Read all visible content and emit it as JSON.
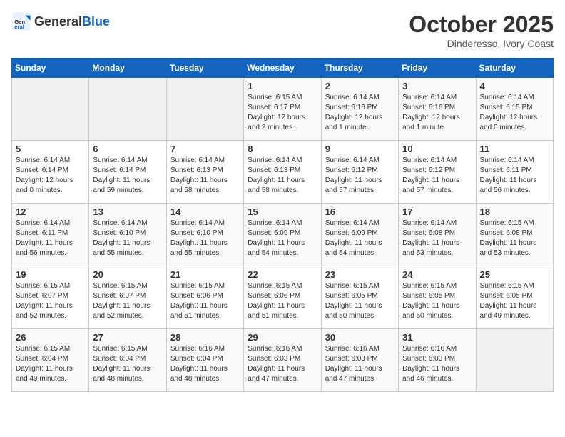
{
  "logo": {
    "general": "General",
    "blue": "Blue"
  },
  "header": {
    "month": "October 2025",
    "location": "Dinderesso, Ivory Coast"
  },
  "weekdays": [
    "Sunday",
    "Monday",
    "Tuesday",
    "Wednesday",
    "Thursday",
    "Friday",
    "Saturday"
  ],
  "weeks": [
    [
      {
        "day": "",
        "info": ""
      },
      {
        "day": "",
        "info": ""
      },
      {
        "day": "",
        "info": ""
      },
      {
        "day": "1",
        "info": "Sunrise: 6:15 AM\nSunset: 6:17 PM\nDaylight: 12 hours\nand 2 minutes."
      },
      {
        "day": "2",
        "info": "Sunrise: 6:14 AM\nSunset: 6:16 PM\nDaylight: 12 hours\nand 1 minute."
      },
      {
        "day": "3",
        "info": "Sunrise: 6:14 AM\nSunset: 6:16 PM\nDaylight: 12 hours\nand 1 minute."
      },
      {
        "day": "4",
        "info": "Sunrise: 6:14 AM\nSunset: 6:15 PM\nDaylight: 12 hours\nand 0 minutes."
      }
    ],
    [
      {
        "day": "5",
        "info": "Sunrise: 6:14 AM\nSunset: 6:14 PM\nDaylight: 12 hours\nand 0 minutes."
      },
      {
        "day": "6",
        "info": "Sunrise: 6:14 AM\nSunset: 6:14 PM\nDaylight: 11 hours\nand 59 minutes."
      },
      {
        "day": "7",
        "info": "Sunrise: 6:14 AM\nSunset: 6:13 PM\nDaylight: 11 hours\nand 58 minutes."
      },
      {
        "day": "8",
        "info": "Sunrise: 6:14 AM\nSunset: 6:13 PM\nDaylight: 11 hours\nand 58 minutes."
      },
      {
        "day": "9",
        "info": "Sunrise: 6:14 AM\nSunset: 6:12 PM\nDaylight: 11 hours\nand 57 minutes."
      },
      {
        "day": "10",
        "info": "Sunrise: 6:14 AM\nSunset: 6:12 PM\nDaylight: 11 hours\nand 57 minutes."
      },
      {
        "day": "11",
        "info": "Sunrise: 6:14 AM\nSunset: 6:11 PM\nDaylight: 11 hours\nand 56 minutes."
      }
    ],
    [
      {
        "day": "12",
        "info": "Sunrise: 6:14 AM\nSunset: 6:11 PM\nDaylight: 11 hours\nand 56 minutes."
      },
      {
        "day": "13",
        "info": "Sunrise: 6:14 AM\nSunset: 6:10 PM\nDaylight: 11 hours\nand 55 minutes."
      },
      {
        "day": "14",
        "info": "Sunrise: 6:14 AM\nSunset: 6:10 PM\nDaylight: 11 hours\nand 55 minutes."
      },
      {
        "day": "15",
        "info": "Sunrise: 6:14 AM\nSunset: 6:09 PM\nDaylight: 11 hours\nand 54 minutes."
      },
      {
        "day": "16",
        "info": "Sunrise: 6:14 AM\nSunset: 6:09 PM\nDaylight: 11 hours\nand 54 minutes."
      },
      {
        "day": "17",
        "info": "Sunrise: 6:14 AM\nSunset: 6:08 PM\nDaylight: 11 hours\nand 53 minutes."
      },
      {
        "day": "18",
        "info": "Sunrise: 6:15 AM\nSunset: 6:08 PM\nDaylight: 11 hours\nand 53 minutes."
      }
    ],
    [
      {
        "day": "19",
        "info": "Sunrise: 6:15 AM\nSunset: 6:07 PM\nDaylight: 11 hours\nand 52 minutes."
      },
      {
        "day": "20",
        "info": "Sunrise: 6:15 AM\nSunset: 6:07 PM\nDaylight: 11 hours\nand 52 minutes."
      },
      {
        "day": "21",
        "info": "Sunrise: 6:15 AM\nSunset: 6:06 PM\nDaylight: 11 hours\nand 51 minutes."
      },
      {
        "day": "22",
        "info": "Sunrise: 6:15 AM\nSunset: 6:06 PM\nDaylight: 11 hours\nand 51 minutes."
      },
      {
        "day": "23",
        "info": "Sunrise: 6:15 AM\nSunset: 6:05 PM\nDaylight: 11 hours\nand 50 minutes."
      },
      {
        "day": "24",
        "info": "Sunrise: 6:15 AM\nSunset: 6:05 PM\nDaylight: 11 hours\nand 50 minutes."
      },
      {
        "day": "25",
        "info": "Sunrise: 6:15 AM\nSunset: 6:05 PM\nDaylight: 11 hours\nand 49 minutes."
      }
    ],
    [
      {
        "day": "26",
        "info": "Sunrise: 6:15 AM\nSunset: 6:04 PM\nDaylight: 11 hours\nand 49 minutes."
      },
      {
        "day": "27",
        "info": "Sunrise: 6:15 AM\nSunset: 6:04 PM\nDaylight: 11 hours\nand 48 minutes."
      },
      {
        "day": "28",
        "info": "Sunrise: 6:16 AM\nSunset: 6:04 PM\nDaylight: 11 hours\nand 48 minutes."
      },
      {
        "day": "29",
        "info": "Sunrise: 6:16 AM\nSunset: 6:03 PM\nDaylight: 11 hours\nand 47 minutes."
      },
      {
        "day": "30",
        "info": "Sunrise: 6:16 AM\nSunset: 6:03 PM\nDaylight: 11 hours\nand 47 minutes."
      },
      {
        "day": "31",
        "info": "Sunrise: 6:16 AM\nSunset: 6:03 PM\nDaylight: 11 hours\nand 46 minutes."
      },
      {
        "day": "",
        "info": ""
      }
    ]
  ]
}
